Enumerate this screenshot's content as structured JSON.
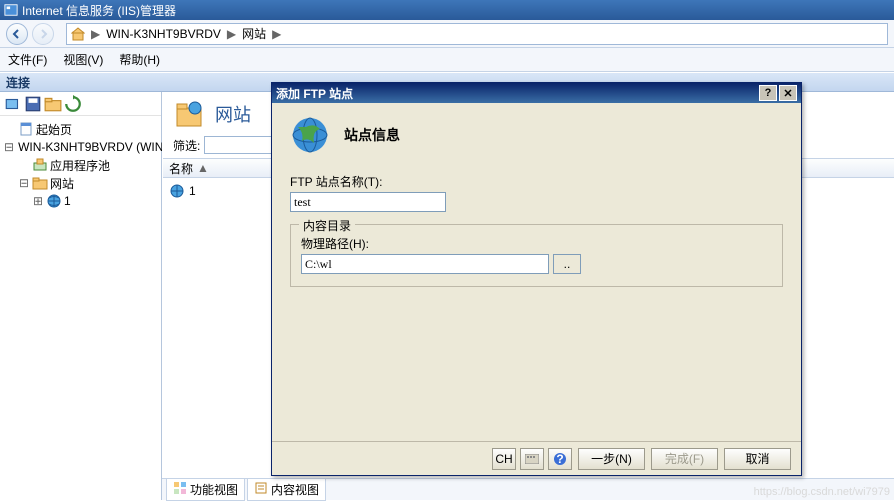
{
  "window": {
    "title": "Internet 信息服务 (IIS)管理器"
  },
  "breadcrumb": {
    "host": "WIN-K3NHT9BVRDV",
    "node": "网站"
  },
  "menu": {
    "file": "文件(F)",
    "view": "视图(V)",
    "help": "帮助(H)"
  },
  "sidebar": {
    "title": "连接",
    "nodes": {
      "start": "起始页",
      "host": "WIN-K3NHT9BVRDV (WIN",
      "apppool": "应用程序池",
      "sites": "网站",
      "site1": "1"
    }
  },
  "content": {
    "heading": "网站",
    "filter_label": "筛选:",
    "filter_value": "",
    "col_name": "名称",
    "row1": "1"
  },
  "tabs": {
    "features": "功能视图",
    "content": "内容视图"
  },
  "dialog": {
    "title": "添加 FTP 站点",
    "section": "站点信息",
    "name_label": "FTP 站点名称(T):",
    "name_value": "test",
    "group_label": "内容目录",
    "path_label": "物理路径(H):",
    "path_value": "C:\\wl",
    "browse": "..",
    "btn_ch": "CH",
    "btn_prev": "一步(N)",
    "btn_finish": "完成(F)",
    "btn_cancel": "取消"
  },
  "watermark": "https://blog.csdn.net/wi7979"
}
